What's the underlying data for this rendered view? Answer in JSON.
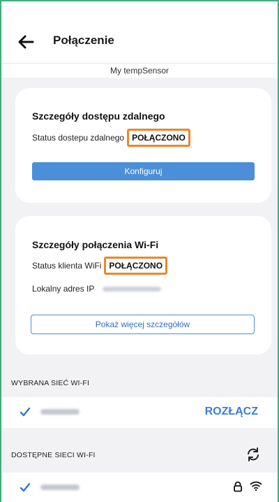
{
  "header": {
    "back_icon": "arrow-left-icon",
    "title": "Połączenie"
  },
  "device_name": "My tempSensor",
  "remote_card": {
    "title": "Szczegóły dostępu zdalnego",
    "status_label": "Status dostepu zdalnego",
    "status_value": "POŁĄCZONO",
    "configure_button": "Konfiguruj"
  },
  "wifi_card": {
    "title": "Szczegóły połączenia Wi-Fi",
    "status_label": "Status klienta WiFi",
    "status_value": "POŁĄCZONO",
    "ip_label": "Lokalny adres IP",
    "more_button": "Pokaż więcej szczegółów"
  },
  "selected_section": {
    "label": "WYBRANA SIEĆ WI-FI",
    "disconnect_label": "ROZŁĄCZ"
  },
  "available_section": {
    "label": "DOSTĘPNE SIECI WI-FI",
    "refresh_icon": "refresh-icon"
  },
  "colors": {
    "accent": "#4b8fd8",
    "highlight": "#e9882a",
    "frame": "#3fae7a"
  }
}
